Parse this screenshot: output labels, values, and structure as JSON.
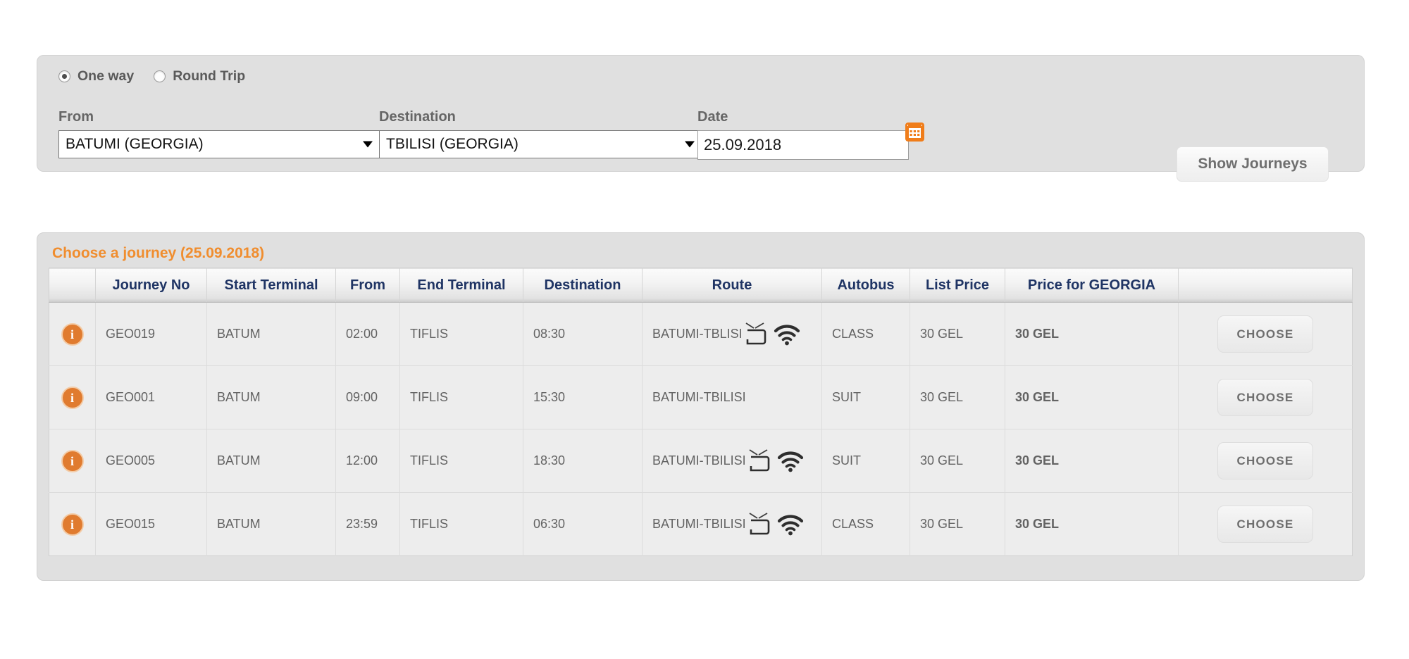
{
  "search": {
    "trip_types": [
      {
        "label": "One way",
        "selected": true
      },
      {
        "label": "Round Trip",
        "selected": false
      }
    ],
    "from": {
      "label": "From",
      "value": "BATUMI (GEORGIA)"
    },
    "destination": {
      "label": "Destination",
      "value": "TBILISI (GEORGIA)"
    },
    "date": {
      "label": "Date",
      "value": "25.09.2018",
      "calendar_icon": "calendar-icon"
    },
    "submit_label": "Show Journeys"
  },
  "results": {
    "title": "Choose a journey (25.09.2018)",
    "columns": [
      "",
      "Journey No",
      "Start Terminal",
      "From",
      "End Terminal",
      "Destination",
      "Route",
      "Autobus",
      "List Price",
      "Price for GEORGIA",
      ""
    ],
    "choose_label": "CHOOSE",
    "info_icon": "info-icon",
    "amenity_icons": [
      "tv-icon",
      "wifi-icon"
    ],
    "price_geo_color": "#2a2ae8",
    "title_color": "#f08d2e",
    "header_text_color": "#1f3464",
    "rows": [
      {
        "journey_no": "GEO019",
        "start_terminal": "BATUM",
        "from": "02:00",
        "end_terminal": "TIFLIS",
        "destination": "08:30",
        "route": "BATUMI-TBLISI",
        "has_tv": true,
        "has_wifi": true,
        "autobus": "CLASS",
        "list_price": "30 GEL",
        "price_georgia": "30 GEL"
      },
      {
        "journey_no": "GEO001",
        "start_terminal": "BATUM",
        "from": "09:00",
        "end_terminal": "TIFLIS",
        "destination": "15:30",
        "route": "BATUMI-TBILISI",
        "has_tv": false,
        "has_wifi": false,
        "autobus": "SUIT",
        "list_price": "30 GEL",
        "price_georgia": "30 GEL"
      },
      {
        "journey_no": "GEO005",
        "start_terminal": "BATUM",
        "from": "12:00",
        "end_terminal": "TIFLIS",
        "destination": "18:30",
        "route": "BATUMI-TBILISI",
        "has_tv": true,
        "has_wifi": true,
        "autobus": "SUIT",
        "list_price": "30 GEL",
        "price_georgia": "30 GEL"
      },
      {
        "journey_no": "GEO015",
        "start_terminal": "BATUM",
        "from": "23:59",
        "end_terminal": "TIFLIS",
        "destination": "06:30",
        "route": "BATUMI-TBILISI",
        "has_tv": true,
        "has_wifi": true,
        "autobus": "CLASS",
        "list_price": "30 GEL",
        "price_georgia": "30 GEL"
      }
    ]
  }
}
